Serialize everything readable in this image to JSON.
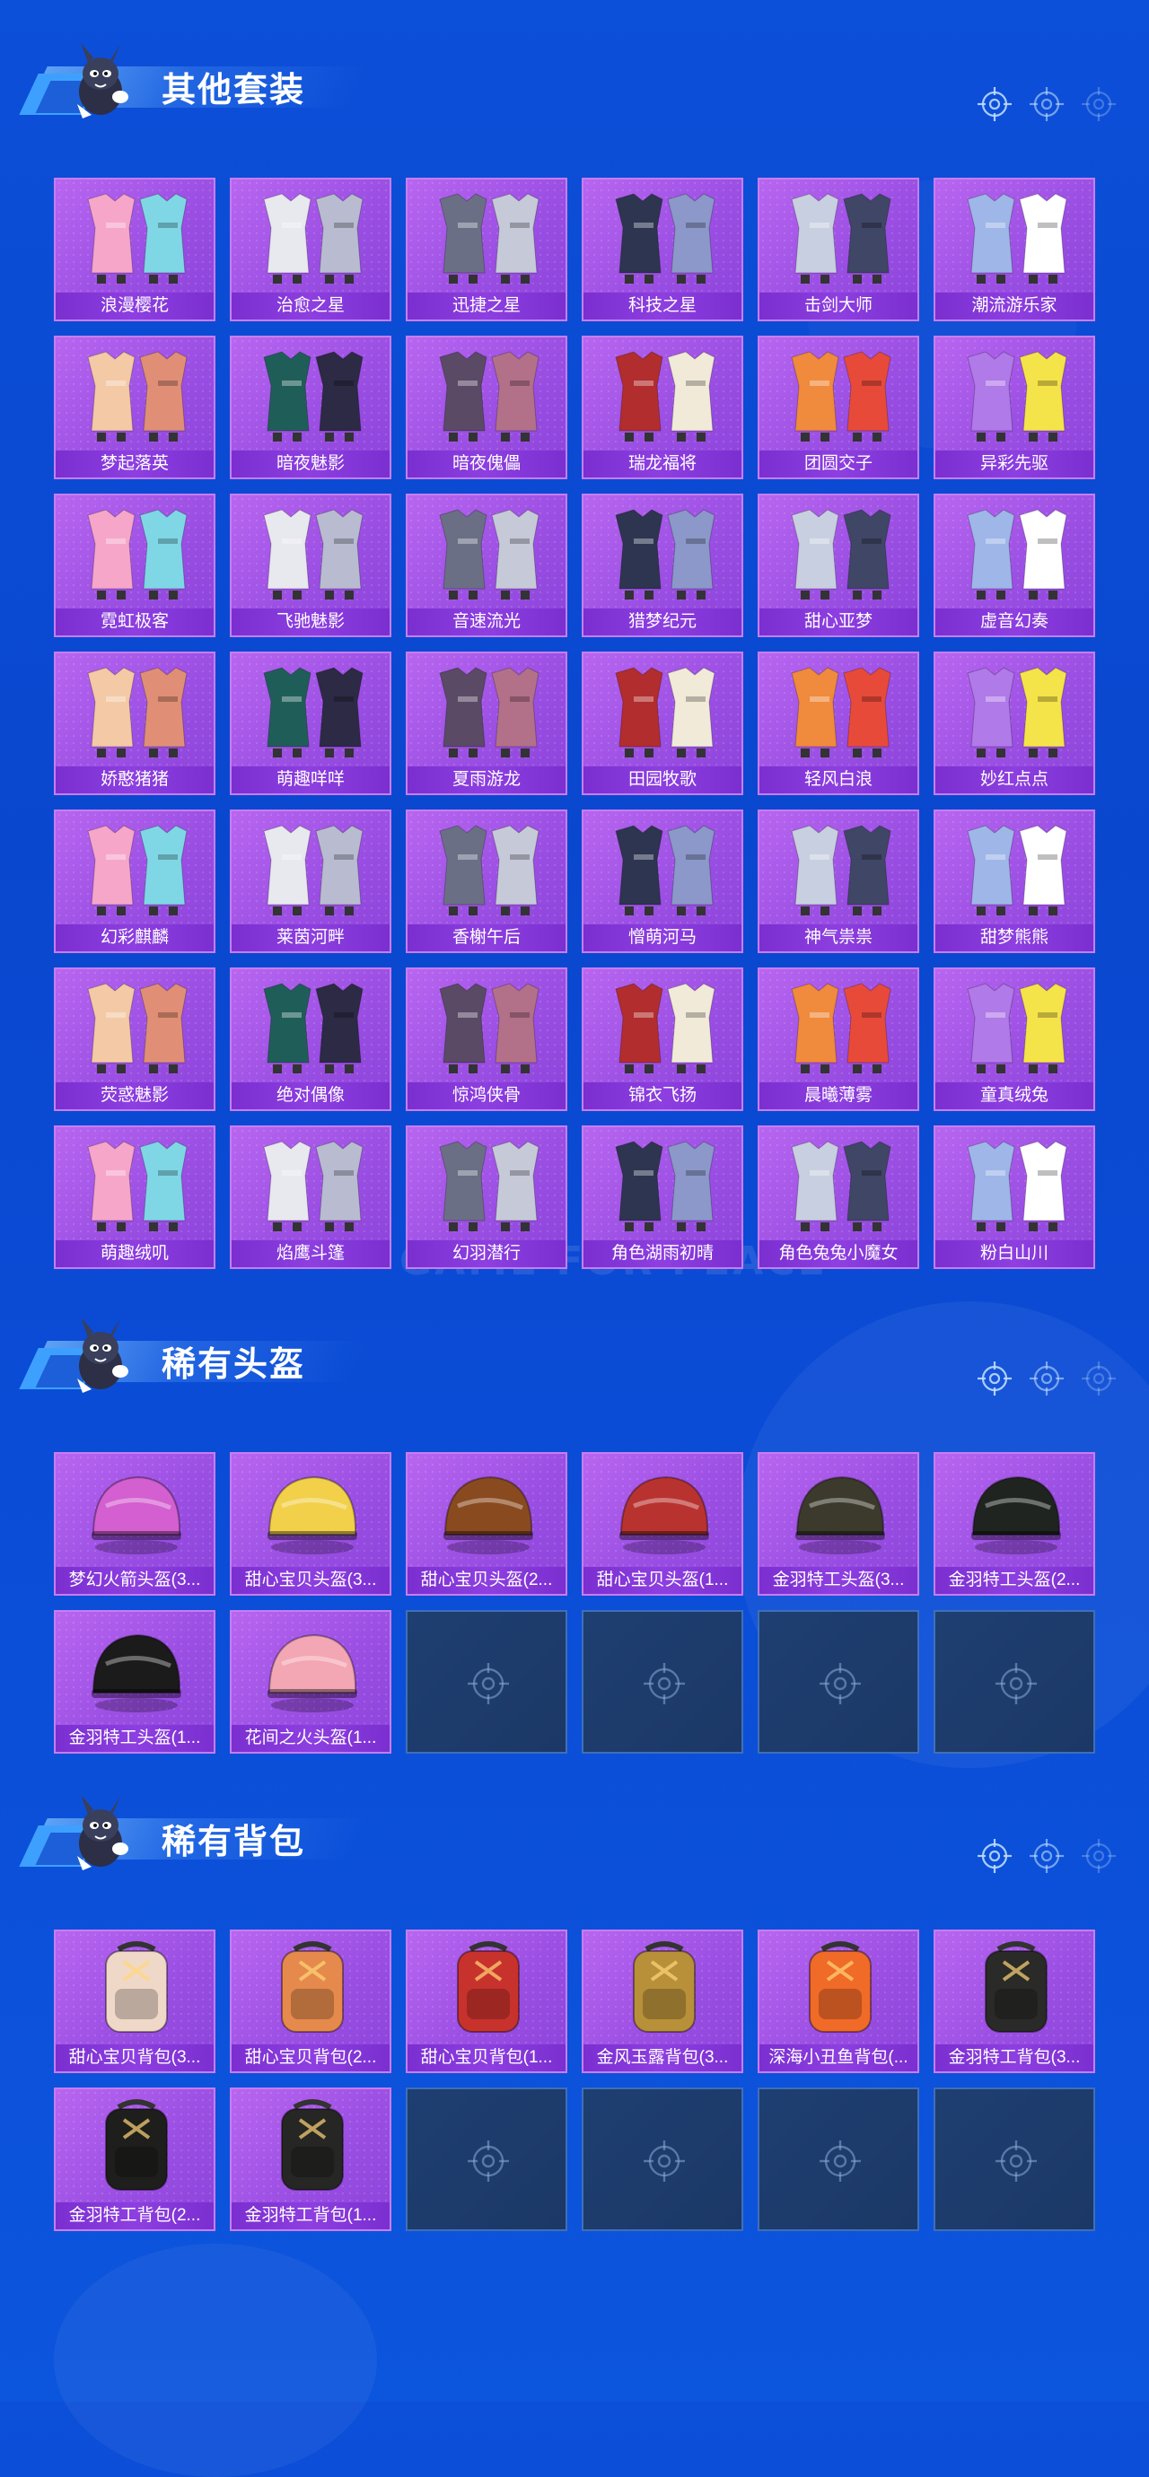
{
  "colors": {
    "background": "#0b4cd6",
    "card_purple": "#a657ea",
    "label_purple": "#7e33d3",
    "empty_slot": "#1e3c6c"
  },
  "watermark": "GAME FOR PEACE",
  "sections": [
    {
      "title": "其他套装",
      "icon": "rabbit-mascot-icon",
      "items": [
        "浪漫樱花",
        "治愈之星",
        "迅捷之星",
        "科技之星",
        "击剑大师",
        "潮流游乐家",
        "梦起落英",
        "暗夜魅影",
        "暗夜傀儡",
        "瑞龙福将",
        "团圆交子",
        "异彩先驱",
        "霓虹极客",
        "飞驰魅影",
        "音速流光",
        "猎梦纪元",
        "甜心亚梦",
        "虚音幻奏",
        "娇憨猪猪",
        "萌趣咩咩",
        "夏雨游龙",
        "田园牧歌",
        "轻风白浪",
        "妙红点点",
        "幻彩麒麟",
        "莱茵河畔",
        "香榭午后",
        "憎萌河马",
        "神气祟祟",
        "甜梦熊熊",
        "荧惑魅影",
        "绝对偶像",
        "惊鸿侠骨",
        "锦衣飞扬",
        "晨曦薄雾",
        "童真绒兔",
        "萌趣绒叽",
        "焰鹰斗篷",
        "幻羽潜行",
        "角色湖雨初晴",
        "角色兔兔小魔女",
        "粉白山川"
      ],
      "empty_slots": 0
    },
    {
      "title": "稀有头盔",
      "icon": "rabbit-mascot-icon",
      "items": [
        "梦幻火箭头盔(3...",
        "甜心宝贝头盔(3...",
        "甜心宝贝头盔(2...",
        "甜心宝贝头盔(1...",
        "金羽特工头盔(3...",
        "金羽特工头盔(2...",
        "金羽特工头盔(1...",
        "花间之火头盔(1..."
      ],
      "empty_slots": 4
    },
    {
      "title": "稀有背包",
      "icon": "rabbit-mascot-icon",
      "items": [
        "甜心宝贝背包(3...",
        "甜心宝贝背包(2...",
        "甜心宝贝背包(1...",
        "金风玉露背包(3...",
        "深海小丑鱼背包(...",
        "金羽特工背包(3...",
        "金羽特工背包(2...",
        "金羽特工背包(1..."
      ],
      "empty_slots": 4
    }
  ]
}
